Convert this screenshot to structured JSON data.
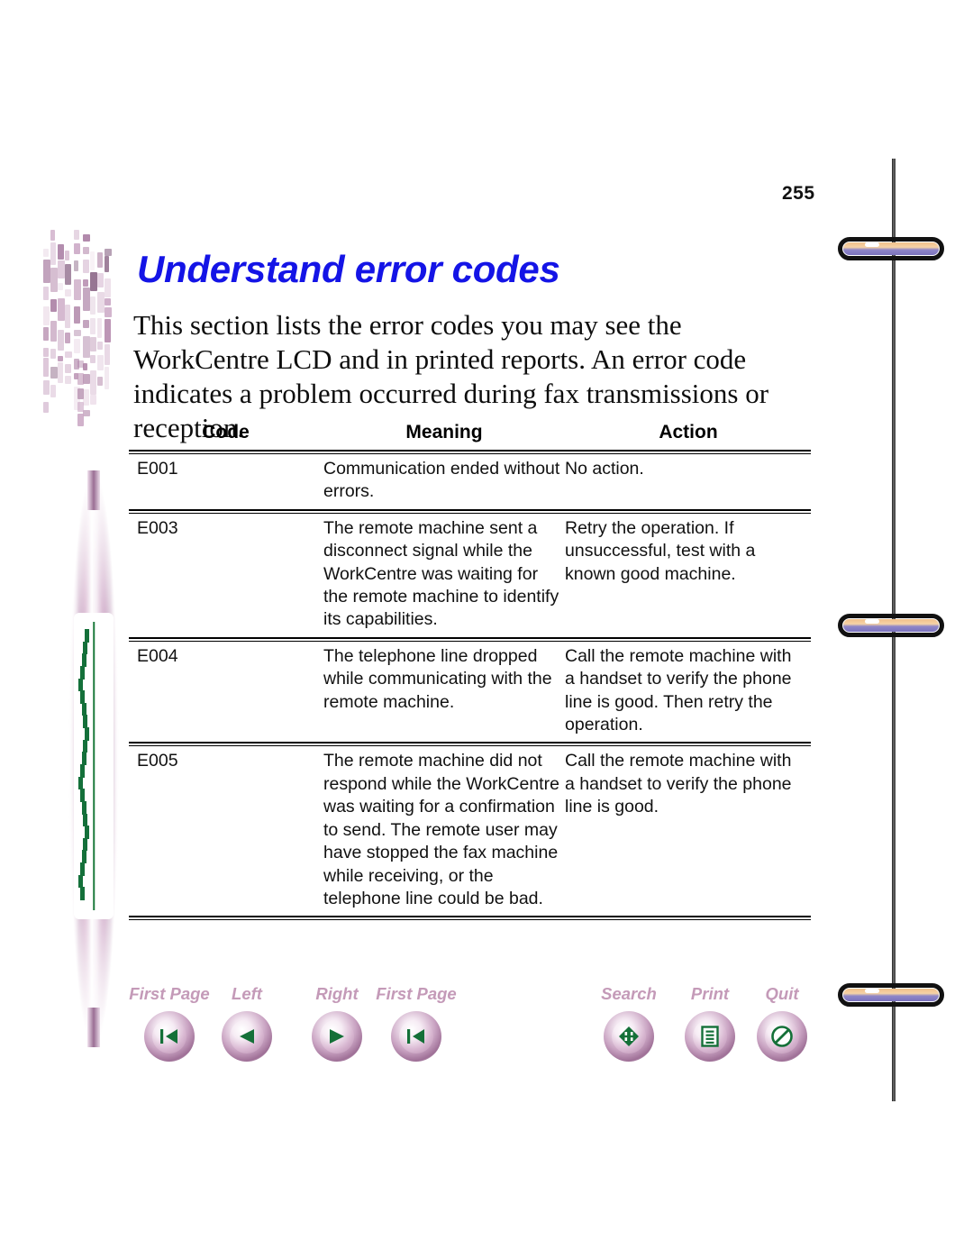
{
  "page": {
    "number": "255",
    "title": "Understand error codes",
    "intro": "This section lists the error codes you may see the WorkCentre LCD and in printed reports. An error code indicates a problem occurred during fax transmissions or reception.",
    "title_color": "#1414E6"
  },
  "table": {
    "headers": {
      "code": "Code",
      "meaning": "Meaning",
      "action": "Action"
    },
    "rows": [
      {
        "code": "E001",
        "meaning": "Communication ended without errors.",
        "action": "No action."
      },
      {
        "code": "E003",
        "meaning": "The remote machine sent a disconnect signal while the WorkCentre was waiting for the remote machine to identify its capabilities.",
        "action": "Retry the operation. If unsuccessful, test with a known good machine."
      },
      {
        "code": "E004",
        "meaning": "The telephone line dropped while communicating with the remote machine.",
        "action": "Call the remote machine with a handset to verify the phone line is good. Then retry the operation."
      },
      {
        "code": "E005",
        "meaning": "The remote machine did not respond while the WorkCentre was waiting for a confirmation to send. The remote user may have stopped the fax machine while receiving, or the telephone line could be bad.",
        "action": "Call the remote machine with a handset to verify the phone line is good."
      }
    ]
  },
  "navigation": {
    "label_color": "#c49ab8",
    "icon_color": "#147038",
    "buttons": [
      {
        "label": "First Page",
        "icon": "first-page-icon"
      },
      {
        "label": "Left",
        "icon": "left-arrow-icon"
      },
      {
        "label": "Right",
        "icon": "right-arrow-icon"
      },
      {
        "label": "First Page",
        "icon": "first-page-icon"
      },
      {
        "label": "Search",
        "icon": "search-h-icon"
      },
      {
        "label": "Print",
        "icon": "print-document-icon"
      },
      {
        "label": "Quit",
        "icon": "quit-no-entry-icon"
      }
    ]
  },
  "decor": {
    "binding_rings": 3,
    "artwork": [
      "abstract-bars-graphic",
      "stylus-pen-graphic"
    ]
  }
}
